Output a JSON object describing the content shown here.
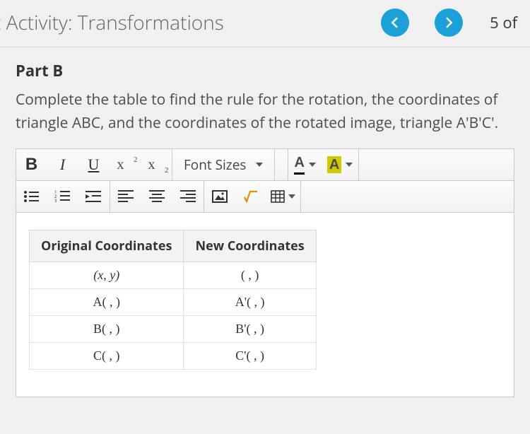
{
  "header": {
    "title": "t Activity: Transformations",
    "page_indicator": "5  of"
  },
  "content": {
    "part_label": "Part B",
    "prompt": "Complete the table to find the rule for the rotation, the coordinates of triangle ABC, and the coordinates of the rotated image, triangle A'B'C'."
  },
  "toolbar": {
    "bold": "B",
    "italic": "I",
    "underline": "U",
    "superscript_base": "x",
    "superscript_mark": "2",
    "subscript_base": "x",
    "subscript_mark": "2",
    "font_sizes_label": "Font Sizes",
    "text_color_label": "A",
    "bg_color_label": "A"
  },
  "table": {
    "headers": {
      "original": "Original Coordinates",
      "new": "New Coordinates"
    },
    "rows": [
      {
        "original": "(x, y)",
        "new": "( , )"
      },
      {
        "original": "A( , )",
        "new": "A'( , )"
      },
      {
        "original": "B( , )",
        "new": "B'( , )"
      },
      {
        "original": "C( , )",
        "new": "C'( , )"
      }
    ]
  }
}
